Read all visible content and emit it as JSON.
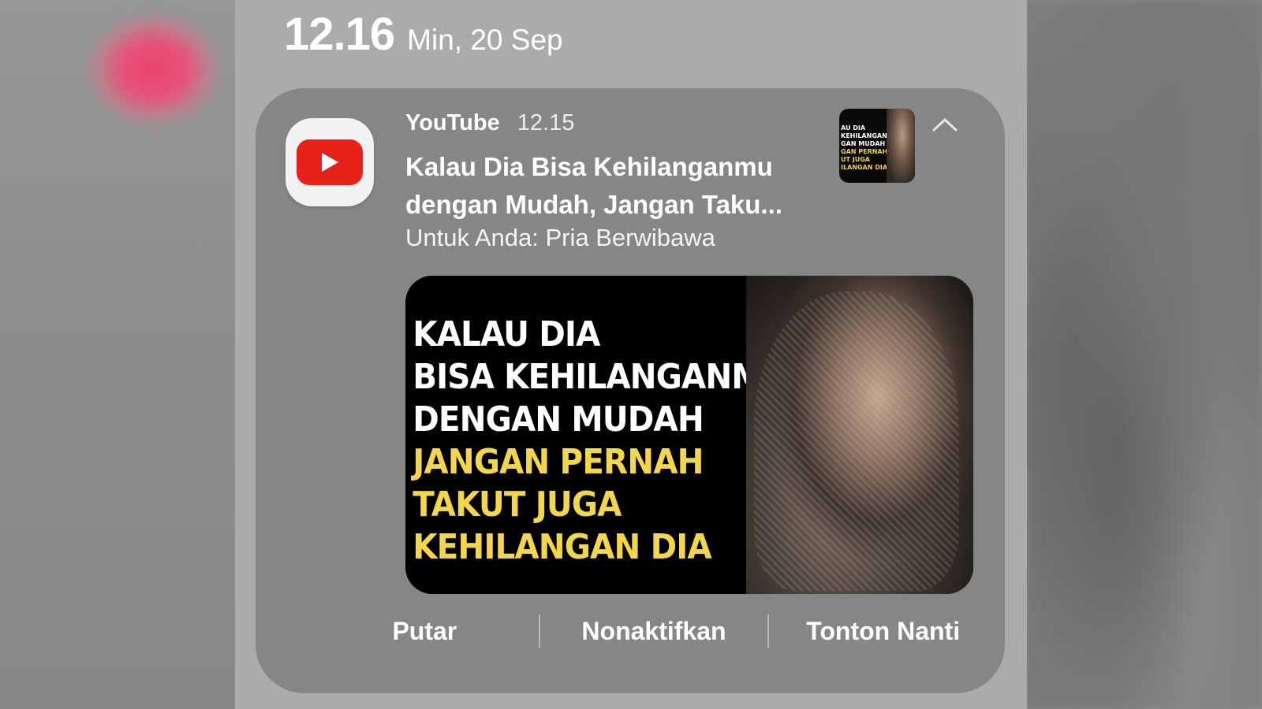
{
  "status_bar": {
    "clock": "12.16",
    "date": "Min, 20 Sep"
  },
  "notification": {
    "app_name": "YouTube",
    "time": "12.15",
    "title": "Kalau Dia Bisa Kehilanganmu dengan Mudah, Jangan Taku...",
    "subtitle": "Untuk Anda: Pria Berwibawa",
    "app_icon": "youtube-play-icon",
    "collapse_icon": "chevron-up-icon",
    "thumbnail_small_lines_white": [
      "AU DIA",
      "KEHILANGANMU",
      "GAN MUDAH"
    ],
    "thumbnail_small_lines_yellow": [
      "GAN PERNAH",
      "UT JUGA",
      "ILANGAN DIA"
    ],
    "thumbnail_lines_white": [
      "KALAU DIA",
      "BISA KEHILANGANMU",
      "DENGAN MUDAH"
    ],
    "thumbnail_lines_yellow": [
      "JANGAN PERNAH",
      "TAKUT JUGA",
      "KEHILANGAN DIA"
    ],
    "actions": {
      "play": "Putar",
      "disable": "Nonaktifkan",
      "watch_later": "Tonton Nanti"
    }
  },
  "colors": {
    "youtube_red": "#e62117",
    "thumbnail_yellow": "#f3d649",
    "card_background": "#868686"
  }
}
